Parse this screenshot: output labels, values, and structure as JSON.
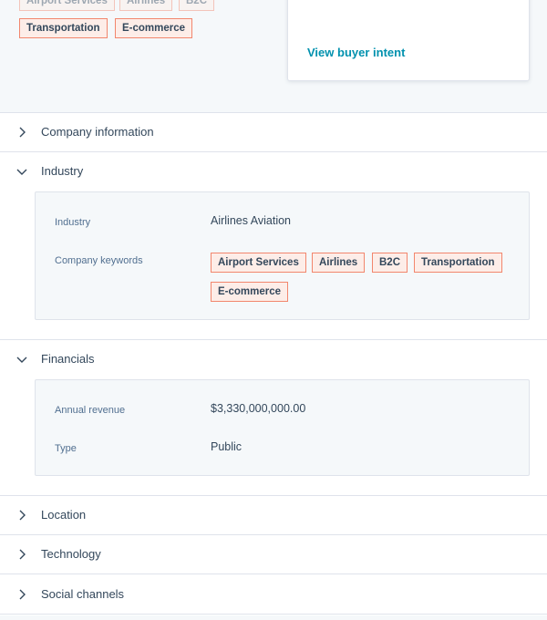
{
  "header": {
    "keywords_row1": [
      "Airport Services",
      "Airlines",
      "B2C"
    ],
    "keywords_row2": [
      "Transportation",
      "E-commerce"
    ],
    "card_link": "View buyer intent"
  },
  "sections": {
    "company_info": {
      "title": "Company information",
      "expanded": false
    },
    "industry": {
      "title": "Industry",
      "expanded": true,
      "industry_label": "Industry",
      "industry_value": "Airlines Aviation",
      "keywords_label": "Company keywords",
      "keywords": [
        "Airport Services",
        "Airlines",
        "B2C",
        "Transportation",
        "E-commerce"
      ]
    },
    "financials": {
      "title": "Financials",
      "expanded": true,
      "revenue_label": "Annual revenue",
      "revenue_value": "$3,330,000,000.00",
      "type_label": "Type",
      "type_value": "Public"
    },
    "location": {
      "title": "Location",
      "expanded": false
    },
    "technology": {
      "title": "Technology",
      "expanded": false
    },
    "social": {
      "title": "Social channels",
      "expanded": false
    }
  },
  "colors": {
    "accent_link": "#0091ae",
    "tag_border": "#f2866d",
    "tag_bg": "#fdede8",
    "panel_bg": "#f5f8fa",
    "divider": "#dfe3eb",
    "text": "#33475b"
  },
  "icons": {
    "collapsed": "chevron-right-icon",
    "expanded": "chevron-down-icon"
  }
}
